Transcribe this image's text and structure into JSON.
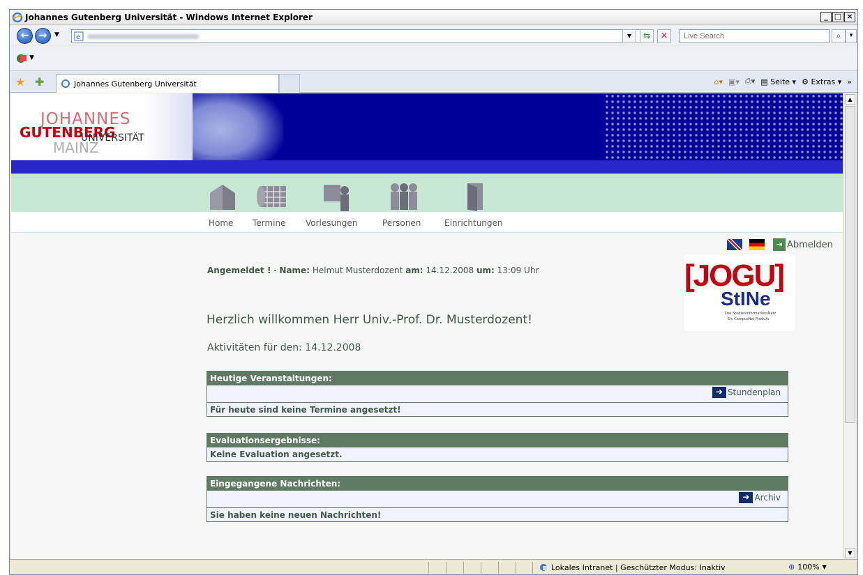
{
  "window": {
    "title": "Johannes Gutenberg Universität - Windows Internet Explorer"
  },
  "browser": {
    "search_placeholder": "Live Search",
    "tab_title": "Johannes Gutenberg Universität",
    "tools": {
      "seite": "Seite",
      "extras": "Extras"
    },
    "status": {
      "zone": "Lokales Intranet | Geschützter Modus: Inaktiv",
      "zoom": "100%"
    }
  },
  "site": {
    "logo": {
      "line1": "JOHANNES",
      "line2": "GUTENBERG",
      "line3": "UNIVERSITÄT",
      "line4": "MAINZ"
    },
    "nav": [
      {
        "label": "Home",
        "icon": "house-icon"
      },
      {
        "label": "Termine",
        "icon": "calendar-icon"
      },
      {
        "label": "Vorlesungen",
        "icon": "lecture-icon"
      },
      {
        "label": "Personen",
        "icon": "people-icon"
      },
      {
        "label": "Einrichtungen",
        "icon": "door-icon"
      }
    ],
    "logout": "Abmelden",
    "status_line": {
      "prefix": "Angemeldet !",
      "name_label": "Name:",
      "name": "Helmut Musterdozent",
      "am_label": "am:",
      "date": "14.12.2008",
      "um_label": "um:",
      "time": "13:09 Uhr"
    },
    "welcome": "Herzlich willkommen Herr Univ.-Prof. Dr. Musterdozent!",
    "activities": "Aktivitäten für den: 14.12.2008",
    "stine_logo": {
      "jogu": "JOGU",
      "stine": "StINe",
      "sub1": "Das StudienInformationsNetz",
      "sub2": "Ein CampusNet Produkt"
    },
    "boxes": {
      "today": {
        "title": "Heutige Veranstaltungen:",
        "link": "Stundenplan",
        "message": "Für heute sind keine Termine angesetzt!"
      },
      "eval": {
        "title": "Evaluationsergebnisse:",
        "message": "Keine Evaluation angesetzt."
      },
      "msgs": {
        "title": "Eingegangene Nachrichten:",
        "link": "Archiv",
        "message": "Sie haben keine neuen Nachrichten!"
      }
    }
  }
}
